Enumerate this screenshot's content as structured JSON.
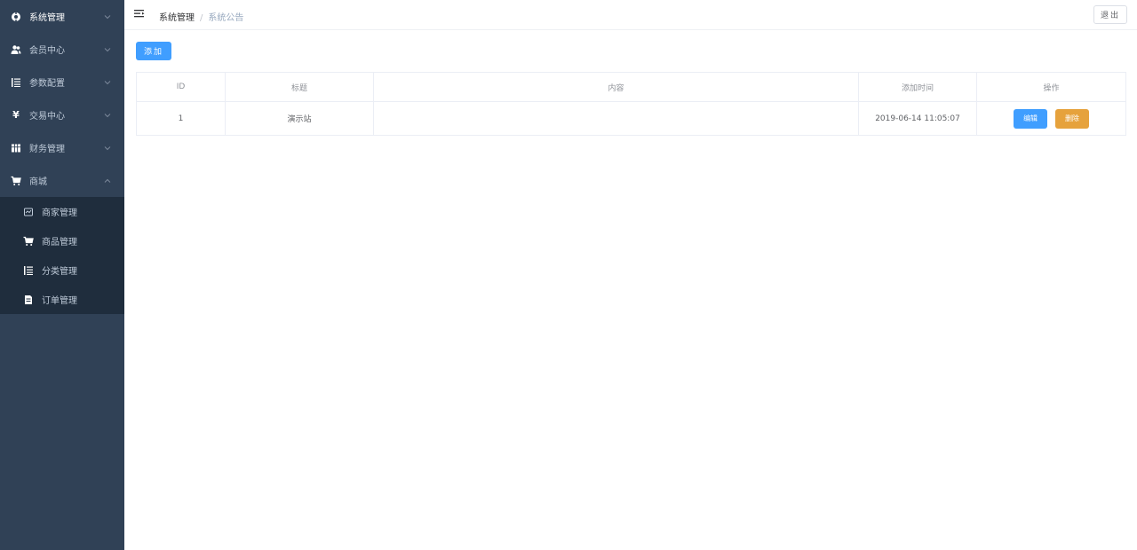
{
  "sidebar": {
    "items": [
      {
        "label": "系统管理",
        "icon": "gear-circle-icon"
      },
      {
        "label": "会员中心",
        "icon": "users-icon"
      },
      {
        "label": "参数配置",
        "icon": "list-icon"
      },
      {
        "label": "交易中心",
        "icon": "yen-icon"
      },
      {
        "label": "财务管理",
        "icon": "grid-icon"
      },
      {
        "label": "商城",
        "icon": "cart-icon"
      }
    ],
    "submenu": [
      {
        "label": "商家管理",
        "icon": "shop-icon"
      },
      {
        "label": "商品管理",
        "icon": "cart-icon"
      },
      {
        "label": "分类管理",
        "icon": "list-icon"
      },
      {
        "label": "订单管理",
        "icon": "order-icon"
      }
    ]
  },
  "header": {
    "breadcrumb_parent": "系统管理",
    "breadcrumb_separator": "/",
    "breadcrumb_current": "系统公告",
    "logout_label": "退出"
  },
  "main": {
    "add_label": "添加",
    "table": {
      "columns": [
        "ID",
        "标题",
        "内容",
        "添加时间",
        "操作"
      ],
      "rows": [
        {
          "id": "1",
          "title": "演示站",
          "content": "",
          "added": "2019-06-14 11:05:07",
          "edit": "编辑",
          "delete": "删除"
        }
      ]
    }
  },
  "colors": {
    "sidebar_bg": "#304156",
    "submenu_bg": "#1f2d3d",
    "primary": "#409eff",
    "warning": "#e6a23c"
  }
}
